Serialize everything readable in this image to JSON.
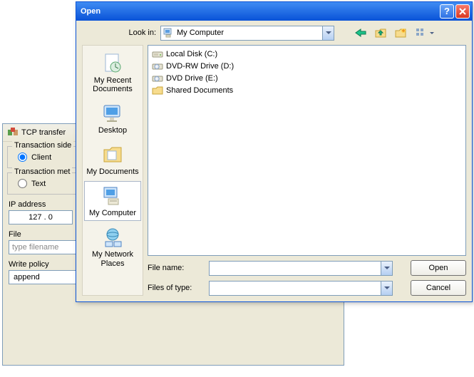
{
  "bgwin": {
    "title": "TCP transfer",
    "group1_label": "Transaction side",
    "radio_client": "Client",
    "group2_label": "Transaction met",
    "radio_text": "Text",
    "ip_label": "IP address",
    "ip_value": "127 .  0",
    "file_label": "File",
    "file_placeholder": "type filename",
    "writepolicy_label": "Write policy",
    "writepolicy_value": "append"
  },
  "dlg": {
    "title": "Open",
    "lookin_label": "Look in:",
    "lookin_value": "My Computer",
    "places": [
      {
        "label": "My Recent Documents",
        "icon": "recentdocs",
        "selected": false
      },
      {
        "label": "Desktop",
        "icon": "desktop",
        "selected": false
      },
      {
        "label": "My Documents",
        "icon": "mydocs",
        "selected": false
      },
      {
        "label": "My Computer",
        "icon": "computer",
        "selected": true
      },
      {
        "label": "My Network Places",
        "icon": "network",
        "selected": false
      }
    ],
    "files": [
      {
        "label": "Local Disk (C:)",
        "icon": "hdd"
      },
      {
        "label": "DVD-RW Drive (D:)",
        "icon": "optical"
      },
      {
        "label": "DVD Drive (E:)",
        "icon": "optical"
      },
      {
        "label": "Shared Documents",
        "icon": "folder"
      }
    ],
    "filename_label": "File name:",
    "filename_value": "",
    "filetype_label": "Files of type:",
    "filetype_value": "",
    "open_btn": "Open",
    "cancel_btn": "Cancel"
  }
}
